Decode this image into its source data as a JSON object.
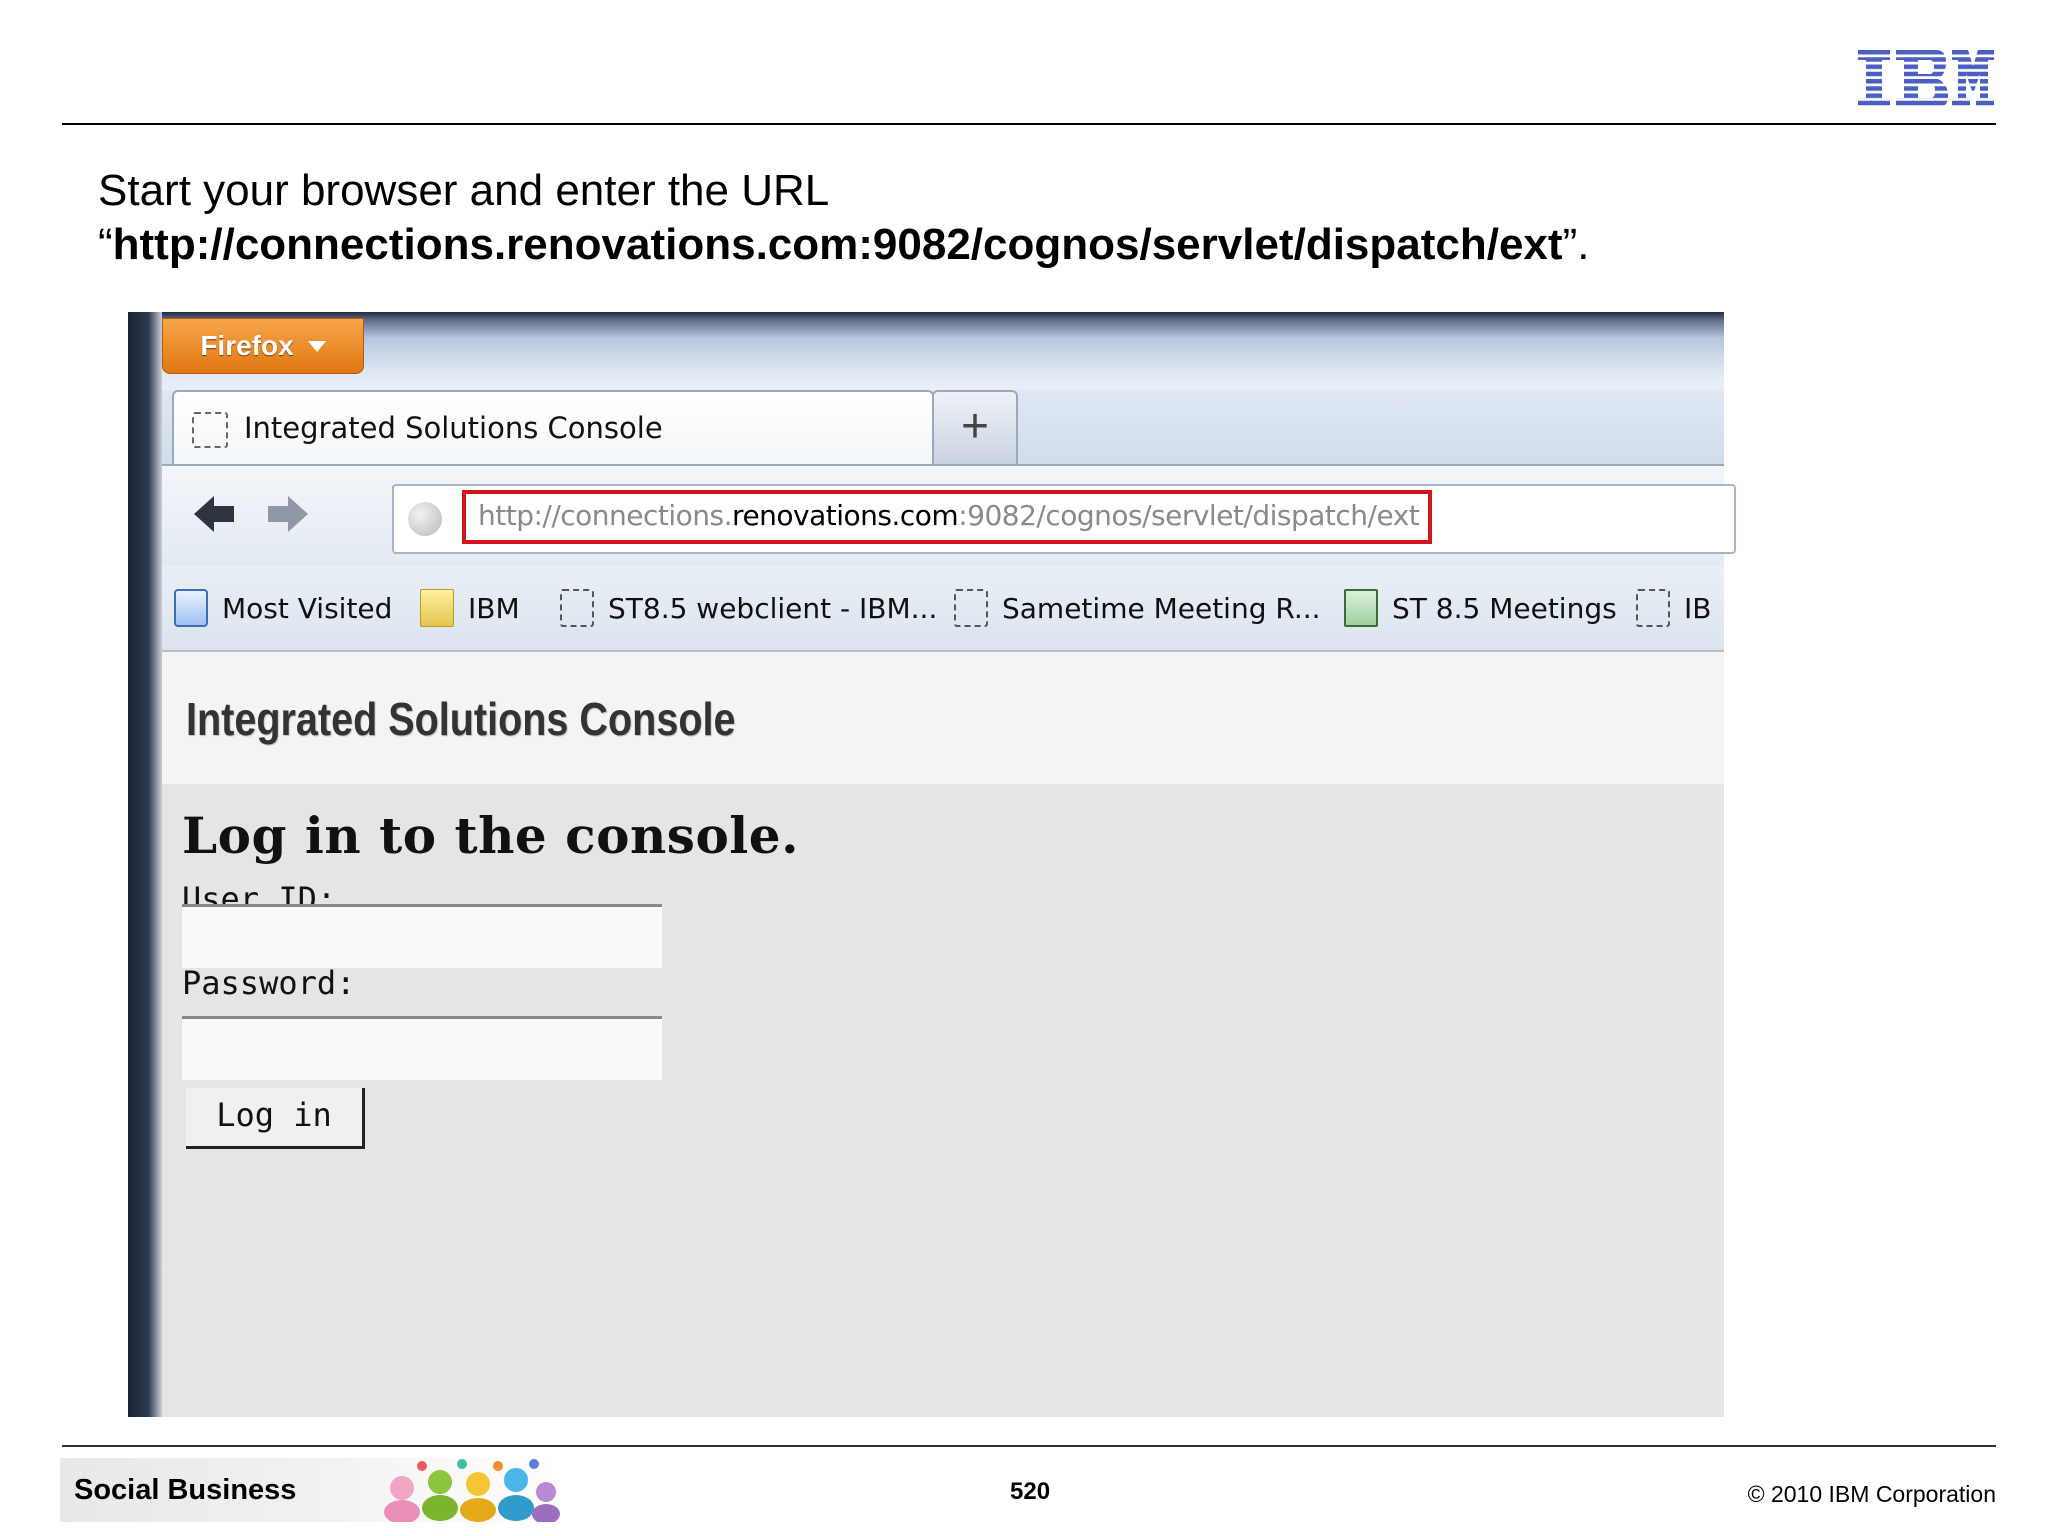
{
  "slide": {
    "instruction_line1": "Start your browser and enter the URL",
    "instruction_quote_open": "“",
    "instruction_url": "http://connections.renovations.com:9082/cognos/servlet/dispatch/ext",
    "instruction_quote_close": "”.",
    "logo_text": "IBM"
  },
  "browser": {
    "firefox_label": "Firefox",
    "tab_title": "Integrated Solutions Console",
    "new_tab_symbol": "+",
    "url_prefix": "http://connections.",
    "url_host": "renovations.com",
    "url_suffix": ":9082/cognos/servlet/dispatch/ext",
    "bookmarks": [
      "Most Visited",
      "IBM",
      "ST8.5 webclient - IBM...",
      "Sametime Meeting R...",
      "ST 8.5 Meetings",
      "IB"
    ]
  },
  "console": {
    "header_title": "Integrated Solutions Console",
    "login_heading": "Log in to the console.",
    "user_id_label": "User ID:",
    "user_id_value": "",
    "password_label": "Password:",
    "password_value": "",
    "login_button": "Log in"
  },
  "footer": {
    "brand": "Social Business",
    "page_number": "520",
    "copyright": "© 2010 IBM Corporation"
  },
  "colors": {
    "url_highlight": "#d0151d",
    "firefox_orange": "#e07812",
    "ibm_blue": "#4a5fc1"
  }
}
